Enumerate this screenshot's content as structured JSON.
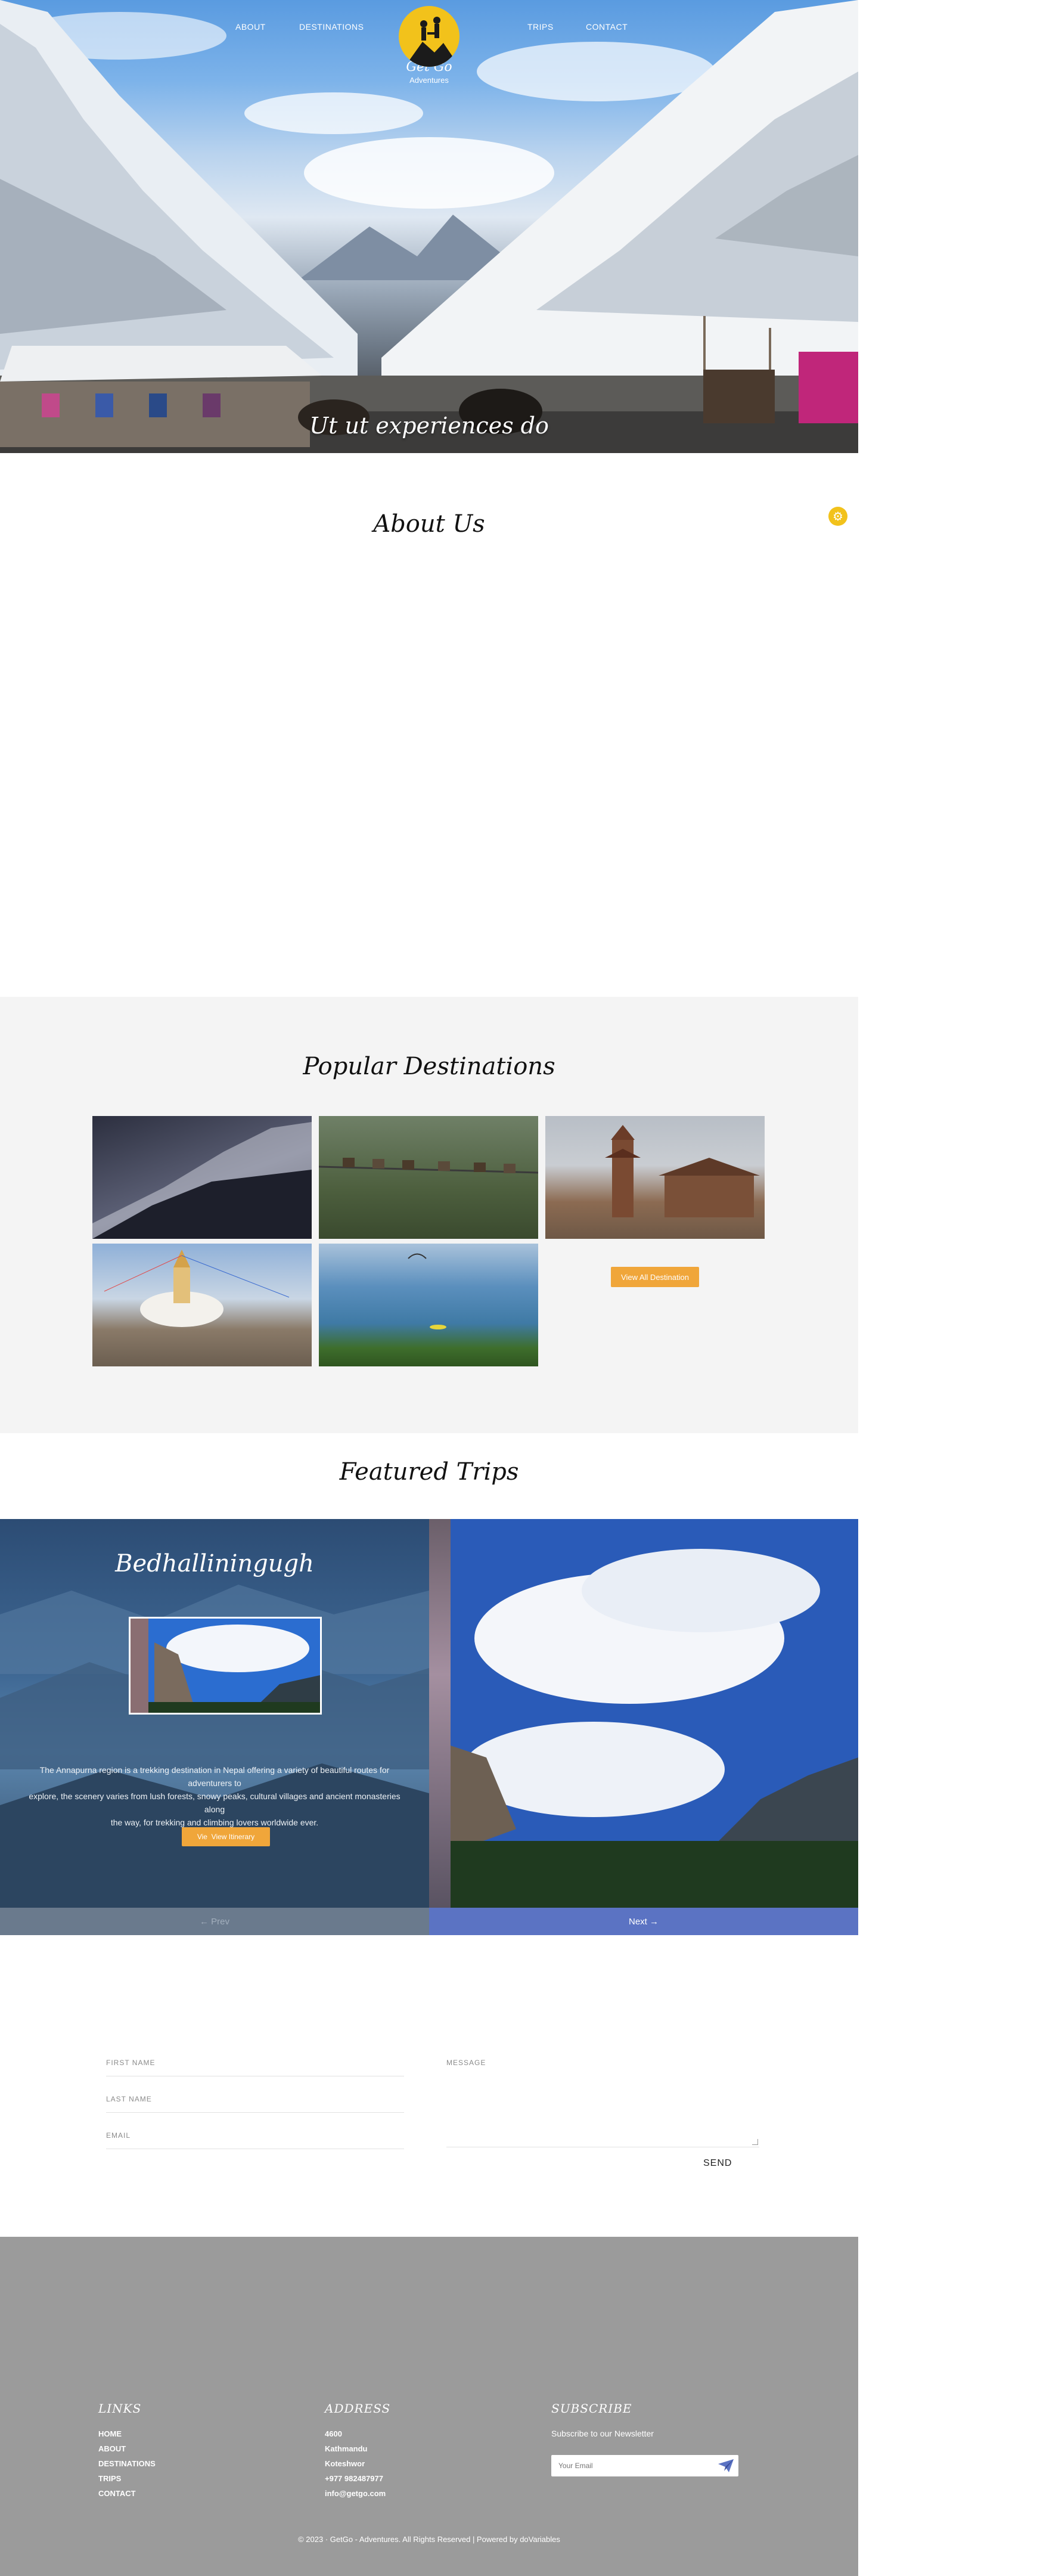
{
  "nav": {
    "about": "ABOUT",
    "destinations": "DESTINATIONS",
    "trips": "TRIPS",
    "contact": "CONTACT",
    "brand": "Get Go",
    "brand_sub": "Adventures"
  },
  "hero": {
    "tagline": "Ut ut experiences do"
  },
  "about": {
    "title": "About Us"
  },
  "popular": {
    "title": "Popular Destinations",
    "view_all": "View All Destination",
    "tiles": [
      "mountain-ridge",
      "suspension-bridge",
      "temple-square",
      "stupa",
      "lake-paragliding"
    ]
  },
  "featured": {
    "title": "Featured Trips",
    "trip_title": "Bedhalliningugh",
    "description_line1": "The Annapurna region is a trekking destination in Nepal offering a variety of beautiful routes for adventurers to",
    "description_line2": "explore, the scenery varies from lush forests, snowy peaks, cultural villages and ancient monasteries along",
    "description_line3": "the way, for trekking and climbing lovers worldwide ever.",
    "itinerary_button": "View Itinerary",
    "itinerary_prefix": "Vie",
    "prev": "← Prev",
    "next": "Next →"
  },
  "contact": {
    "first_name": "FIRST NAME",
    "last_name": "LAST NAME",
    "email": "EMAIL",
    "message": "MESSAGE",
    "send": "SEND"
  },
  "footer": {
    "links_heading": "LINKS",
    "links": [
      "HOME",
      "ABOUT",
      "DESTINATIONS",
      "TRIPS",
      "CONTACT"
    ],
    "address_heading": "ADDRESS",
    "address": [
      "4600",
      "Kathmandu",
      "Koteshwor",
      "+977 982487977",
      "info@getgo.com"
    ],
    "subscribe_heading": "SUBSCRIBE",
    "subscribe_text": "Subscribe to our Newsletter",
    "email_placeholder": "Your Email",
    "copyright": "© 2023 · GetGo - Adventures. All Rights Reserved | Powered by doVariables"
  },
  "colors": {
    "accent": "#f0a63a",
    "logo_yellow": "#f2c21b",
    "footer_bg": "#9b9b9b",
    "next_bar": "#5b73c3"
  }
}
